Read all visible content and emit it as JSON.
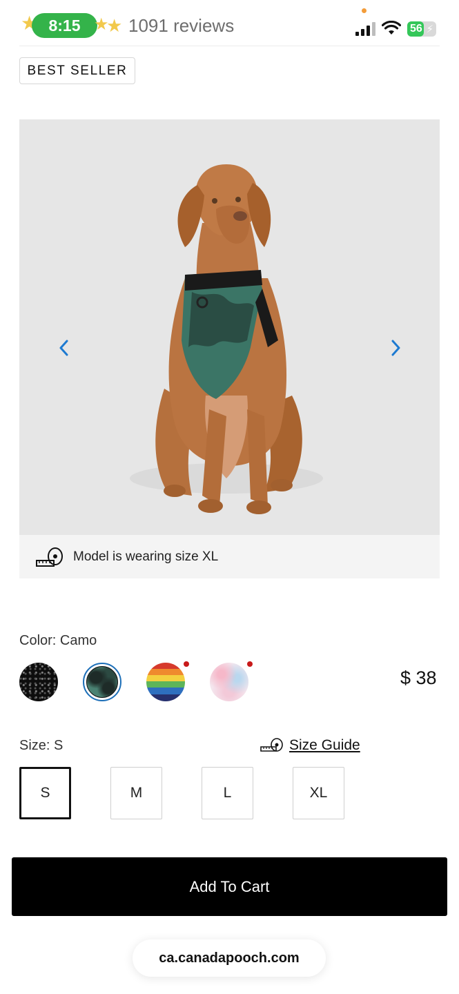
{
  "status_bar": {
    "time": "8:15",
    "reviews": "1091 reviews",
    "battery": "56",
    "battery_level": 0.56
  },
  "badge": {
    "label": "BEST SELLER"
  },
  "gallery": {
    "image_alt": "Dog wearing camo harness",
    "prev_icon": "chevron-left-icon",
    "next_icon": "chevron-right-icon",
    "model_note": "Model is wearing size XL"
  },
  "colors": {
    "label": "Color: Camo",
    "swatches": [
      {
        "name": "black-speckle",
        "selected": false,
        "new": false
      },
      {
        "name": "camo",
        "selected": true,
        "new": false
      },
      {
        "name": "rainbow",
        "selected": false,
        "new": true
      },
      {
        "name": "pastel-tie-dye",
        "selected": false,
        "new": true
      }
    ],
    "accent": "#1d6fb8"
  },
  "price": "$ 38",
  "sizes": {
    "label": "Size: S",
    "guide_label": "Size Guide",
    "options": [
      "S",
      "M",
      "L",
      "XL"
    ],
    "selected": "S"
  },
  "cart": {
    "label": "Add To Cart"
  },
  "browser": {
    "url": "ca.canadapooch.com"
  }
}
